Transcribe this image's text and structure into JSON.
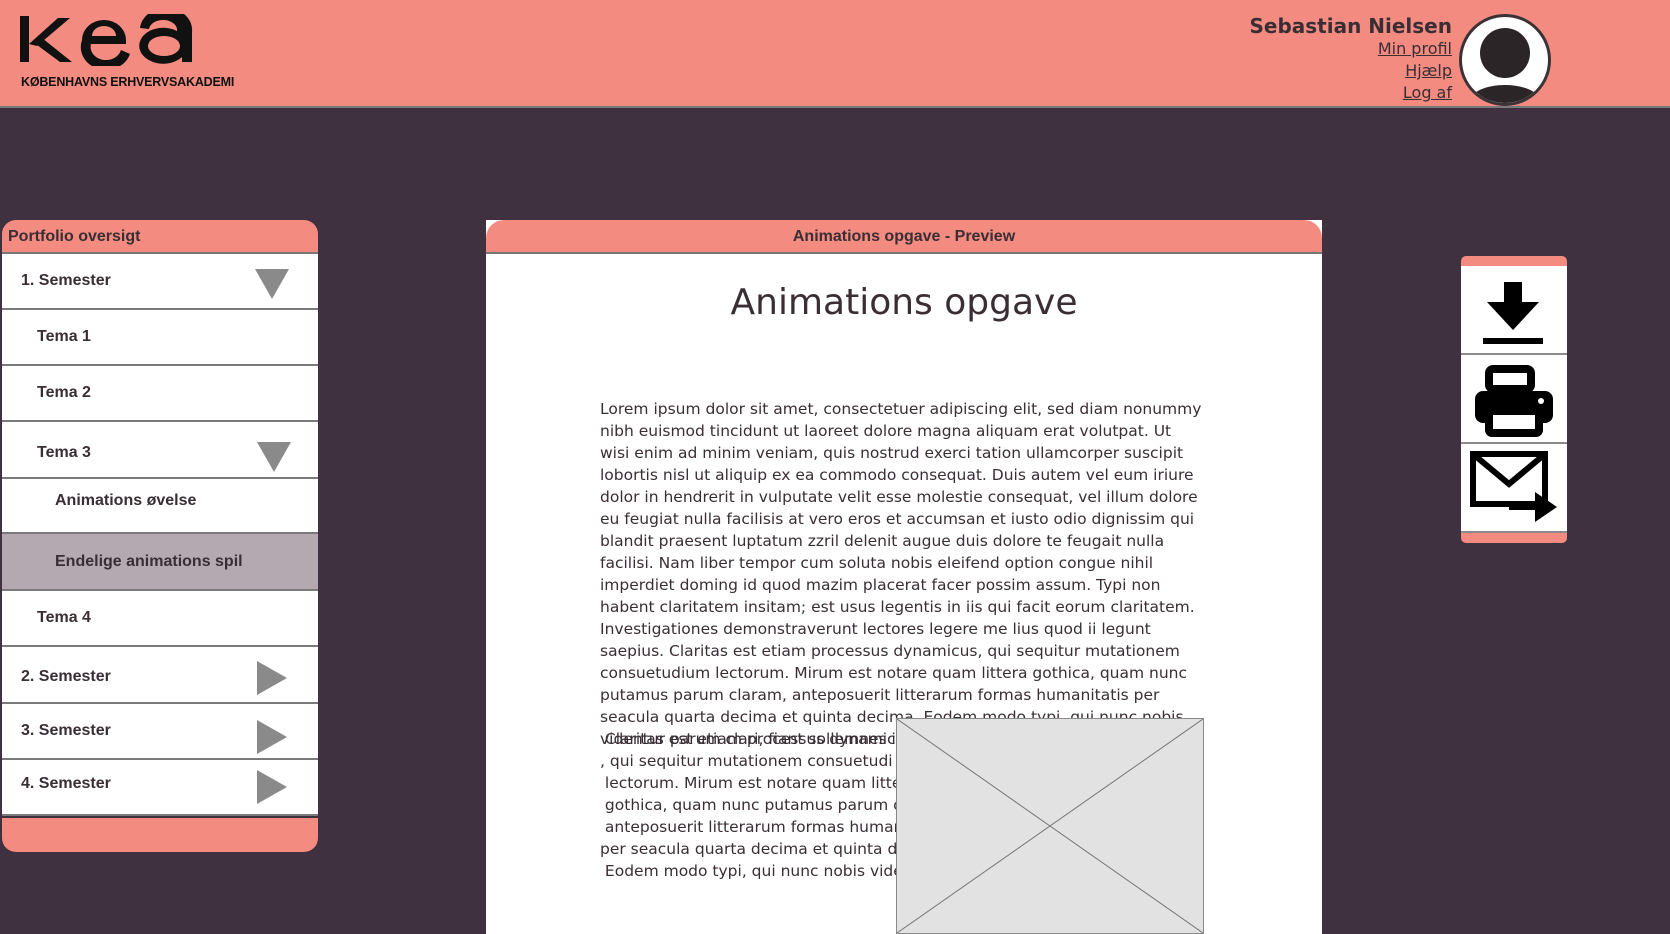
{
  "header": {
    "logo_text": "kea",
    "logo_subtitle": "KØBENHAVNS ERHVERVSAKADEMI",
    "user": {
      "name": "Sebastian Nielsen",
      "links": [
        "Min profil",
        "Hjælp",
        "Log af"
      ]
    },
    "avatar_icon": "user-avatar-icon"
  },
  "sidebar": {
    "title": "Portfolio oversigt",
    "items": [
      {
        "label": "1. Semester",
        "level": 0,
        "expander": "expanded"
      },
      {
        "label": "Tema 1",
        "level": 1
      },
      {
        "label": "Tema 2",
        "level": 1
      },
      {
        "label": "Tema 3",
        "level": 1,
        "expander": "expanded"
      },
      {
        "label": "Animations øvelse",
        "level": 2
      },
      {
        "label": "Endelige animations spil",
        "level": 2,
        "selected": true
      },
      {
        "label": "Tema 4",
        "level": 1
      },
      {
        "label": "2. Semester",
        "level": 0,
        "expander": "collapsed"
      },
      {
        "label": "3. Semester",
        "level": 0,
        "expander": "collapsed"
      },
      {
        "label": "4. Semester",
        "level": 0,
        "expander": "collapsed"
      }
    ]
  },
  "preview": {
    "header": "Animations opgave - Preview",
    "title": "Animations opgave",
    "body": "Lorem ipsum dolor sit amet, consectetuer adipiscing elit, sed diam nonummy nibh euismod tincidunt ut laoreet dolore magna aliquam erat volutpat. Ut wisi enim ad minim veniam, quis nostrud exerci tation ullamcorper suscipit lobortis nisl ut aliquip ex ea commodo consequat. Duis autem vel eum iriure dolor in hendrerit in vulputate velit esse molestie consequat, vel illum dolore eu feugiat nulla facilisis at vero eros et accumsan et iusto odio dignissim qui blandit praesent luptatum zzril delenit augue duis dolore te feugait nulla facilisi. Nam liber tempor cum soluta nobis eleifend option congue nihil imperdiet doming id quod mazim placerat facer possim assum. Typi non habent claritatem insitam; est usus legentis in iis qui facit eorum claritatem. Investigationes demonstraverunt lectores legere me lius quod ii legunt saepius. Claritas est etiam processus dynamicus, qui sequitur mutationem consuetudium lectorum. Mirum est notare quam littera gothica, quam nunc putamus parum claram, anteposuerit litterarum formas humanitatis per seacula quarta decima et quinta decima. Eodem modo typi, qui nunc nobis videntur parum clari, fiant sollemnes in futurum.",
    "body2": " Claritas est etiam processus dynamicu\n, qui sequitur mutationem consuetudi\n lectorum. Mirum est notare quam litte\n gothica, quam nunc putamus parum cl\n anteposuerit litterarum formas humanit\nper seacula quarta decima et quinta de\n Eodem modo typi, qui nunc nobis vide",
    "image_placeholder": "image-placeholder-icon"
  },
  "toolbar": {
    "buttons": [
      {
        "name": "download-button",
        "icon": "download-icon"
      },
      {
        "name": "print-button",
        "icon": "printer-icon"
      },
      {
        "name": "send-email-button",
        "icon": "mail-forward-icon"
      }
    ]
  },
  "colors": {
    "accent": "#f48b80",
    "background": "#3f3140",
    "text": "#3a2e35",
    "selected": "#b4a9b1",
    "triangle": "#8a8a8a"
  }
}
